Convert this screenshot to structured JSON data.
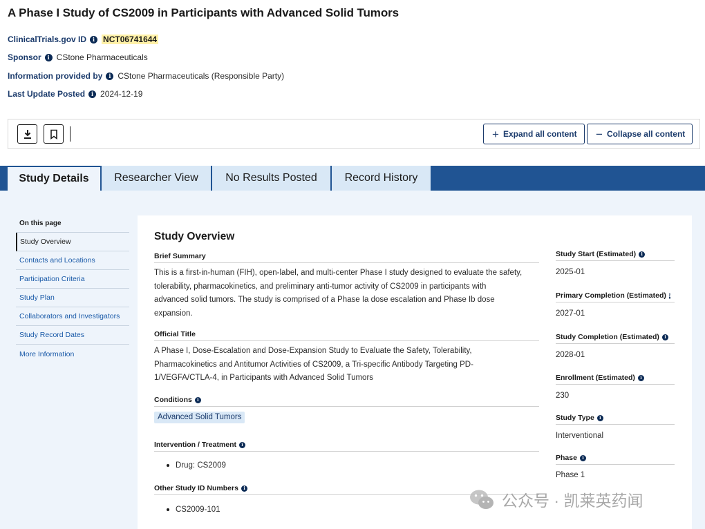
{
  "page": {
    "title": "A Phase I Study of CS2009 in Participants with Advanced Solid Tumors"
  },
  "meta": [
    {
      "label": "ClinicalTrials.gov ID",
      "value": "NCT06741644"
    },
    {
      "label": "Sponsor",
      "value": "CStone Pharmaceuticals"
    },
    {
      "label": "Information provided by",
      "value": "CStone Pharmaceuticals (Responsible Party)"
    },
    {
      "label": "Last Update Posted",
      "value": "2024-12-19"
    }
  ],
  "toolbar": {
    "download_icon": "download-icon",
    "bookmark_icon": "bookmark-icon",
    "expand_label": "Expand all content",
    "collapse_label": "Collapse all content"
  },
  "tabs": [
    {
      "label": "Study Details",
      "active": true
    },
    {
      "label": "Researcher View",
      "active": false
    },
    {
      "label": "No Results Posted",
      "active": false
    },
    {
      "label": "Record History",
      "active": false
    }
  ],
  "side_nav": {
    "heading": "On this page",
    "items": [
      "Study Overview",
      "Contacts and Locations",
      "Participation Criteria",
      "Study Plan",
      "Collaborators and Investigators",
      "Study Record Dates",
      "More Information"
    ]
  },
  "overview": {
    "title": "Study Overview",
    "brief_summary_label": "Brief Summary",
    "brief_summary_lines": [
      "This is a first-in-human (FIH), open-label, and multi-center Phase I study designed to evaluate the safety,",
      "tolerability, pharmacokinetics, and preliminary anti-tumor activity of CS2009 in participants with",
      "advanced solid tumors. The study is comprised of a Phase Ia dose escalation and Phase Ib dose",
      "expansion."
    ],
    "official_title_label": "Official Title",
    "official_title_lines": [
      "A Phase I, Dose-Escalation and Dose-Expansion Study to Evaluate the Safety, Tolerability,",
      "Pharmacokinetics and Antitumor Activities of CS2009, a Tri-specific Antibody Targeting PD-",
      "1/VEGFA/CTLA-4, in Participants with Advanced Solid Tumors"
    ],
    "conditions_label": "Conditions",
    "condition": "Advanced Solid Tumors",
    "intervention_label": "Intervention / Treatment",
    "intervention": "Drug: CS2009",
    "other_ids_label": "Other Study ID Numbers",
    "other_id": "CS2009-101"
  },
  "facts": [
    {
      "label": "Study Start (Estimated)",
      "value": "2025-01"
    },
    {
      "label": "Primary Completion (Estimated)",
      "value": "2027-01"
    },
    {
      "label": "Study Completion (Estimated)",
      "value": "2028-01"
    },
    {
      "label": "Enrollment (Estimated)",
      "value": "230"
    },
    {
      "label": "Study Type",
      "value": "Interventional"
    },
    {
      "label": "Phase",
      "value": "Phase 1"
    }
  ],
  "watermark": {
    "text": "公众号 · 凯莱英药闻"
  },
  "colors": {
    "tab_bar": "#205493",
    "tab_inactive": "#d9e8f6",
    "content_bg": "#eef4fb",
    "label_navy": "#1a3a6b",
    "link_blue": "#1a5aa8",
    "highlight": "#fff1a8"
  }
}
